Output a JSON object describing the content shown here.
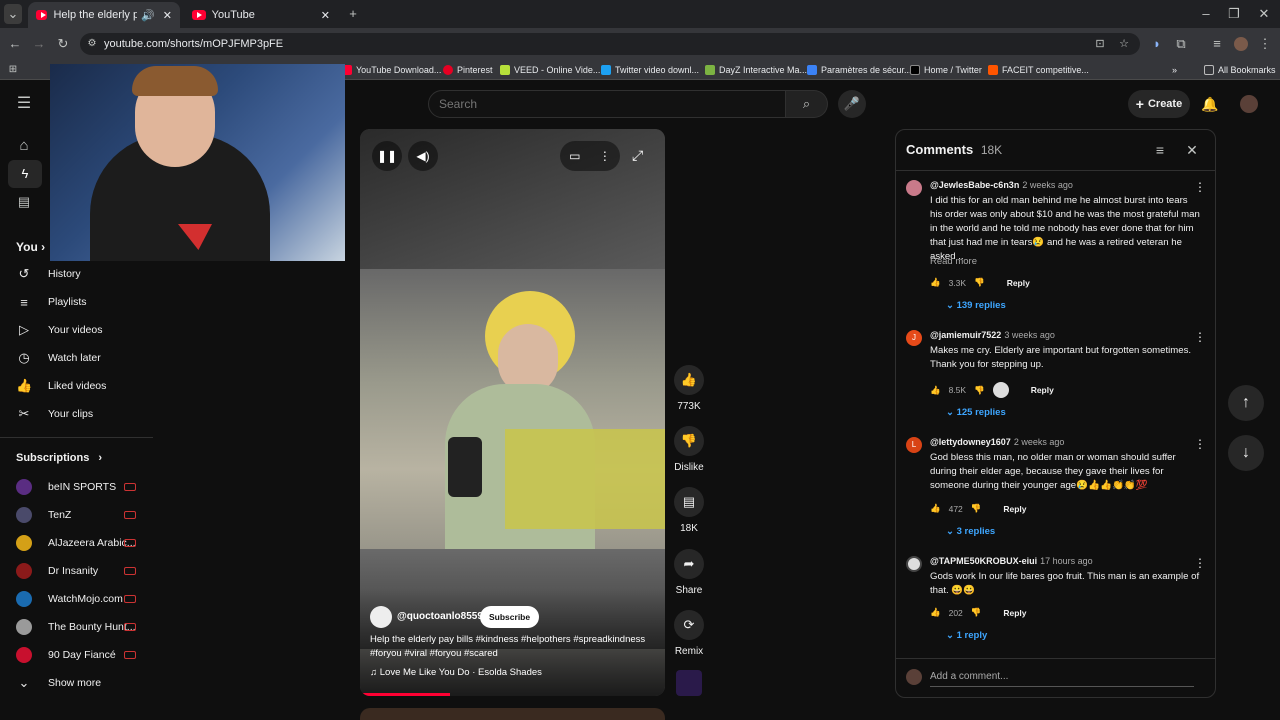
{
  "browser": {
    "tabs": [
      {
        "title": "Help the elderly pay bills #ki"
      },
      {
        "title": "YouTube"
      }
    ],
    "url": "youtube.com/shorts/mOPJFMP3pFE",
    "bookmarks": [
      "YouTube Download...",
      "Pinterest",
      "VEED - Online Vide...",
      "Twitter video downl...",
      "DayZ Interactive Ma...",
      "Paramètres de sécur...",
      "Home / Twitter",
      "FACEIT competitive..."
    ],
    "all_bookmarks": "All Bookmarks"
  },
  "yt": {
    "search_placeholder": "Search",
    "create_label": "Create",
    "sidebar": {
      "you": "You",
      "items": [
        "History",
        "Playlists",
        "Your videos",
        "Watch later",
        "Liked videos",
        "Your clips"
      ],
      "subscriptions_title": "Subscriptions",
      "subscriptions": [
        "beIN SPORTS",
        "TenZ",
        "AlJazeera Arabic...",
        "Dr Insanity",
        "WatchMojo.com",
        "The Bounty Hunt...",
        "90 Day Fiancé"
      ],
      "show_more": "Show more"
    },
    "short": {
      "channel": "@quoctoanlo8559",
      "subscribe": "Subscribe",
      "caption_line1": "Help the elderly pay bills #kindness #helpothers #spreadkindness",
      "caption_line2": "#foryou #viral #foryou #scared",
      "music": "Love Me Like You Do · Esolda Shades",
      "likes": "773K",
      "dislike": "Dislike",
      "comments": "18K",
      "share": "Share",
      "remix": "Remix"
    },
    "comments": {
      "title": "Comments",
      "count": "18K",
      "add_placeholder": "Add a comment...",
      "items": [
        {
          "user": "@JewlesBabe-c6n3n",
          "time": "2 weeks ago",
          "text": "I did this for an old man behind me he almost burst into tears his order was only about $10 and he was the most grateful man in the world and he told me nobody has ever done that for him that just had me in tears😢 and he was a retired veteran he asked ..",
          "read_more": "Read more",
          "likes": "3.3K",
          "reply": "Reply",
          "replies": "139 replies",
          "color": "#c97a8a"
        },
        {
          "user": "@jamiemuir7522",
          "time": "3 weeks ago",
          "text": "Makes me cry. Elderly are important but forgotten sometimes. Thank you for stepping up.",
          "likes": "8.5K",
          "reply": "Reply",
          "replies": "125 replies",
          "color": "#e64a19",
          "initial": "J"
        },
        {
          "user": "@lettydowney1607",
          "time": "2 weeks ago",
          "text": "God bless this man, no older man or woman should suffer during their elder age, because they gave their lives for someone during their younger age😢👍👍👏👏💯",
          "likes": "472",
          "reply": "Reply",
          "replies": "3 replies",
          "color": "#d84315",
          "initial": "L"
        },
        {
          "user": "@TAPME50KROBUX-eiui",
          "time": "17 hours ago",
          "text": "Gods work In our life bares goo fruit. This man is an example of that. 😀😀",
          "likes": "202",
          "reply": "Reply",
          "replies": "1 reply",
          "color": "#ddd"
        }
      ]
    }
  }
}
